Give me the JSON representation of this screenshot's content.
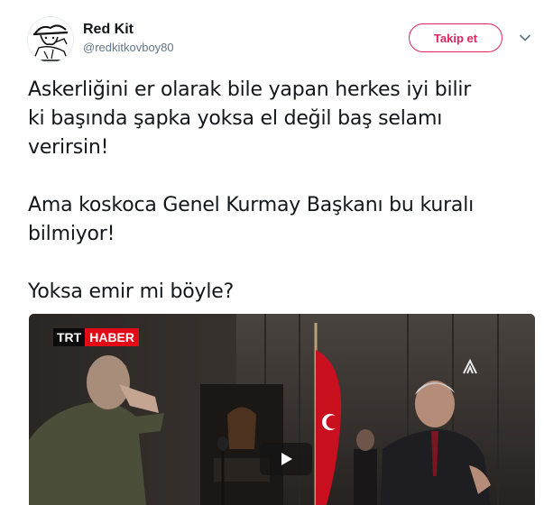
{
  "user": {
    "display_name": "Red Kit",
    "handle": "@redkitkovboy80"
  },
  "actions": {
    "follow_label": "Takip et",
    "more_icon": "chevron-down-icon"
  },
  "tweet": {
    "lines_p1": [
      "Askerliğini er olarak bile yapan herkes iyi bilir",
      "ki başında şapka yoksa el değil baş selamı",
      "verirsin!"
    ],
    "lines_p2": [
      "Ama koskoca Genel Kurmay Başkanı bu kuralı",
      "bilmiyor!"
    ],
    "lines_p3": [
      "Yoksa emir mi böyle?"
    ]
  },
  "media": {
    "channel_part1": "TRT",
    "channel_part2": "HABER",
    "agency_icon": "aa-logo-icon",
    "play_icon": "play-icon"
  },
  "colors": {
    "follow_accent": "#e0245e",
    "text": "#14171a",
    "muted": "#657786",
    "haber_red": "#e30a17"
  }
}
